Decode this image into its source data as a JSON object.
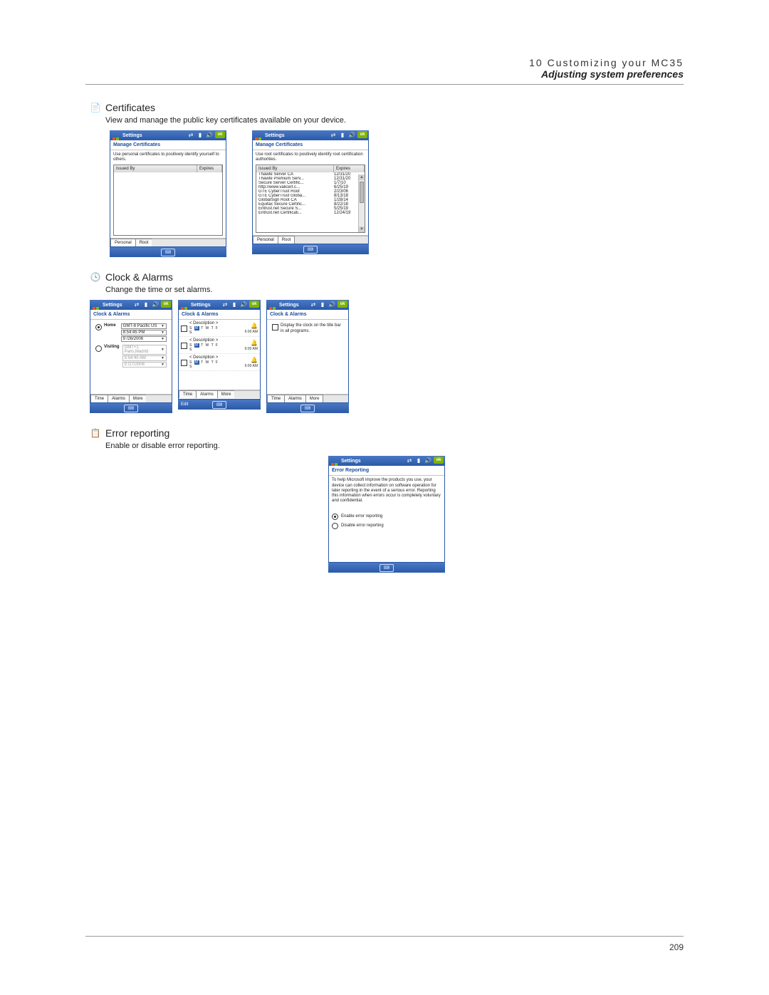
{
  "header": {
    "chapter": "10 Customizing your MC35",
    "subtitle": "Adjusting system preferences"
  },
  "page_number": "209",
  "sections": {
    "certificates": {
      "title": "Certificates",
      "desc": "View and manage the public key certificates available on your device.",
      "personal": {
        "top_title": "Settings",
        "sub_title": "Manage Certificates",
        "hint": "Use personal certificates to positively identify yourself to others.",
        "col1": "Issued By",
        "col2": "Expires",
        "tab_personal": "Personal",
        "tab_root": "Root",
        "ok": "ok"
      },
      "root": {
        "top_title": "Settings",
        "sub_title": "Manage Certificates",
        "hint": "Use root certificates to positively identify root certification authorities.",
        "col1": "Issued By",
        "col2": "Expires",
        "rows": [
          {
            "n": "Thawte Server CA",
            "d": "12/31/20"
          },
          {
            "n": "Thawte Premium Serv...",
            "d": "12/31/20"
          },
          {
            "n": "Secure Server Certific...",
            "d": "1/7/10"
          },
          {
            "n": "http://www.valicert.c...",
            "d": "6/25/19"
          },
          {
            "n": "GTE CyberTrust Root",
            "d": "2/23/06"
          },
          {
            "n": "GTE CyberTrust Globa...",
            "d": "8/13/18"
          },
          {
            "n": "GlobalSign Root CA",
            "d": "1/28/14"
          },
          {
            "n": "Equifax Secure Certific...",
            "d": "8/22/18"
          },
          {
            "n": "Entrust.net Secure S...",
            "d": "5/25/19"
          },
          {
            "n": "Entrust.net Certificati...",
            "d": "12/24/19"
          }
        ],
        "tab_personal": "Personal",
        "tab_root": "Root",
        "ok": "ok"
      }
    },
    "clock": {
      "title": "Clock & Alarms",
      "desc": "Change the time or set alarms.",
      "time": {
        "top_title": "Settings",
        "sub_title": "Clock & Alarms",
        "home": "Home",
        "visiting": "Visiting",
        "tz": "GMT-8 Pacific US",
        "t": "8:54:45 PM",
        "d": "9 /26/2006",
        "tz2": "GMT+1 Paris,Madrid",
        "t2": "5:54:45 AM",
        "d2": "9 /27/2006",
        "tab_time": "Time",
        "tab_alarms": "Alarms",
        "tab_more": "More",
        "ok": "ok"
      },
      "alarms": {
        "top_title": "Settings",
        "sub_title": "Clock & Alarms",
        "desc_label": "< Description >",
        "days_s": "S",
        "days_m": "M",
        "days_t": "T",
        "days_w": "W",
        "days_t2": "T",
        "days_f": "F",
        "days_s2": "S",
        "time": "6:00 AM",
        "tab_time": "Time",
        "tab_alarms": "Alarms",
        "tab_more": "More",
        "edit": "Edit",
        "ok": "ok"
      },
      "more": {
        "top_title": "Settings",
        "sub_title": "Clock & Alarms",
        "opt": "Display the clock on the title bar in all programs.",
        "tab_time": "Time",
        "tab_alarms": "Alarms",
        "tab_more": "More",
        "ok": "ok"
      }
    },
    "error": {
      "title": "Error reporting",
      "desc": "Enable or disable error reporting.",
      "shot": {
        "top_title": "Settings",
        "sub_title": "Error Reporting",
        "body": "To help Microsoft improve the products you use, your device can collect information on software operation for later reporting in the event of a serious error. Reporting this information when errors occur is completely voluntary and confidential.",
        "opt1": "Enable error reporting",
        "opt2": "Disable error reporting",
        "ok": "ok"
      }
    }
  }
}
